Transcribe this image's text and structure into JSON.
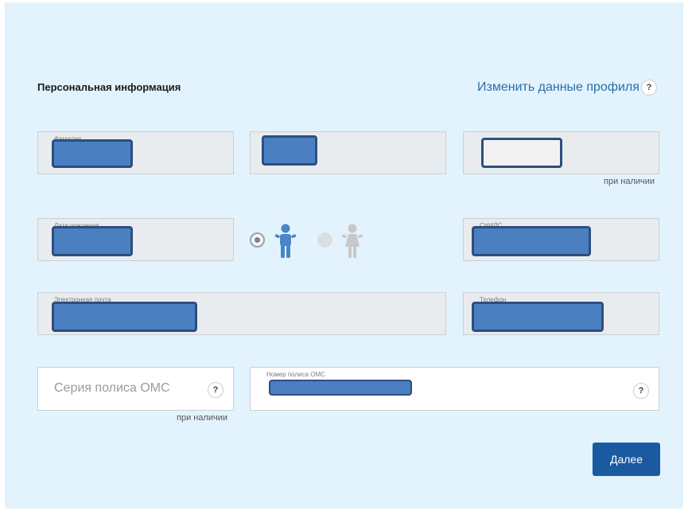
{
  "section": {
    "title": "Персональная информация",
    "edit_link": "Изменить данные профиля",
    "help_glyph": "?"
  },
  "fields": {
    "surname": {
      "label": "Фамилия",
      "value_redacted": true
    },
    "name": {
      "label": "",
      "value_redacted": true
    },
    "patronymic": {
      "label": "",
      "value_redacted": true,
      "hint": "при наличии"
    },
    "birth_date": {
      "label": "Дата рождения",
      "value_redacted": true
    },
    "snils": {
      "label": "СНИЛС",
      "value_redacted": true
    },
    "email": {
      "label": "Электронная почта",
      "value_redacted": true
    },
    "phone": {
      "label": "Телефон",
      "value_redacted": true
    },
    "oms_series": {
      "placeholder": "Серия полиса ОМС",
      "hint": "при наличии"
    },
    "oms_number": {
      "label": "Номер полиса ОМС",
      "value_redacted": true
    }
  },
  "gender": {
    "options": [
      {
        "id": "male",
        "selected": true,
        "icon": "male-person-icon",
        "color": "#4a86c5"
      },
      {
        "id": "female",
        "selected": false,
        "icon": "female-person-icon",
        "color": "#c8c8c8"
      }
    ]
  },
  "actions": {
    "next_label": "Далее"
  },
  "colors": {
    "panel_bg": "#e3f3fd",
    "link": "#2a6ea8",
    "button": "#1a5aa0",
    "redaction_fill": "#4a7fc1"
  }
}
